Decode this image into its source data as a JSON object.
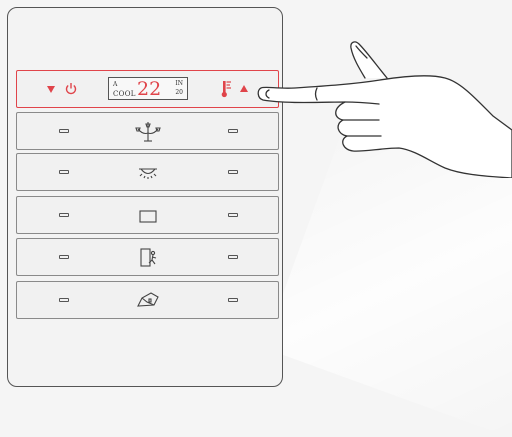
{
  "colors": {
    "accent": "#e0444a",
    "outline": "#555555",
    "panel": "#f3f3f3"
  },
  "thermostat": {
    "mode_letter": "A",
    "mode": "COOL",
    "temperature": "22",
    "indoor_label": "IN",
    "indoor_value": "20",
    "icons": [
      "down-arrow-icon",
      "power-icon",
      "thermometer-icon",
      "up-arrow-icon"
    ]
  },
  "buttons": [
    {
      "icon": "chandelier-icon"
    },
    {
      "icon": "ceiling-light-icon"
    },
    {
      "icon": "rectangle-icon"
    },
    {
      "icon": "door-exit-icon"
    },
    {
      "icon": "house-icon"
    }
  ],
  "hand": {
    "icon": "pointing-hand-icon"
  }
}
